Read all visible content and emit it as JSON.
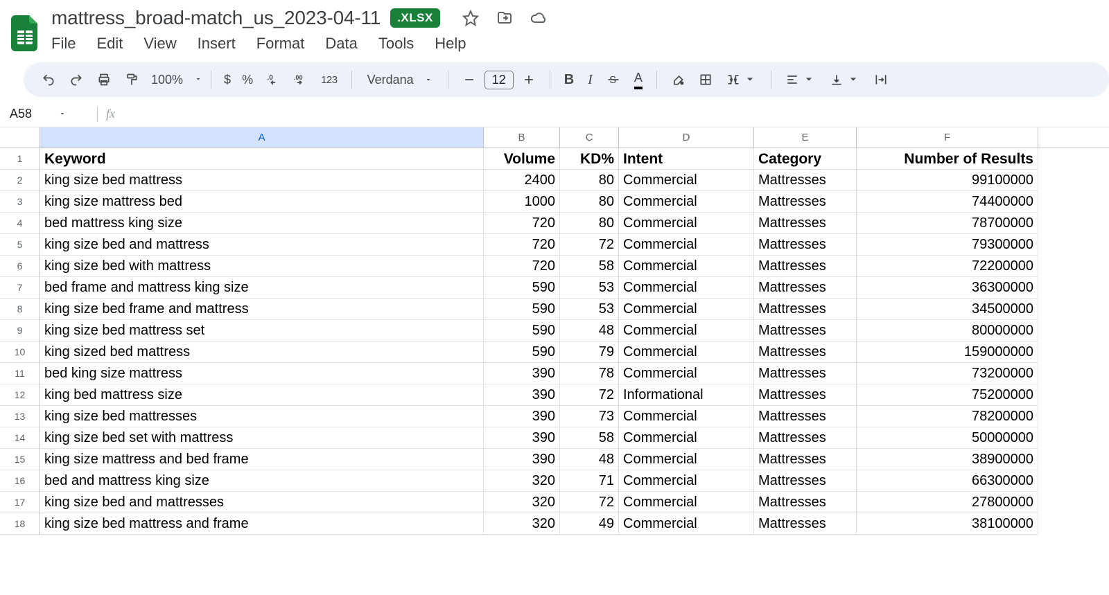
{
  "header": {
    "title": "mattress_broad-match_us_2023-04-11",
    "badge": ".XLSX"
  },
  "menus": [
    "File",
    "Edit",
    "View",
    "Insert",
    "Format",
    "Data",
    "Tools",
    "Help"
  ],
  "toolbar": {
    "zoom": "100%",
    "currency": "$",
    "percent": "%",
    "number_label": "123",
    "font": "Verdana",
    "font_size": "12",
    "text_color_char": "A"
  },
  "fx": {
    "cell_ref": "A58",
    "fx_symbol": "fx",
    "value": ""
  },
  "columns": [
    "A",
    "B",
    "C",
    "D",
    "E",
    "F"
  ],
  "table": {
    "headers": [
      "Keyword",
      "Volume",
      "KD%",
      "Intent",
      "Category",
      "Number of Results"
    ],
    "rows": [
      {
        "n": 2,
        "keyword": "king size bed mattress",
        "volume": 2400,
        "kd": 80,
        "intent": "Commercial",
        "category": "Mattresses",
        "results": 99100000
      },
      {
        "n": 3,
        "keyword": "king size mattress bed",
        "volume": 1000,
        "kd": 80,
        "intent": "Commercial",
        "category": "Mattresses",
        "results": 74400000
      },
      {
        "n": 4,
        "keyword": "bed mattress king size",
        "volume": 720,
        "kd": 80,
        "intent": "Commercial",
        "category": "Mattresses",
        "results": 78700000
      },
      {
        "n": 5,
        "keyword": "king size bed and mattress",
        "volume": 720,
        "kd": 72,
        "intent": "Commercial",
        "category": "Mattresses",
        "results": 79300000
      },
      {
        "n": 6,
        "keyword": "king size bed with mattress",
        "volume": 720,
        "kd": 58,
        "intent": "Commercial",
        "category": "Mattresses",
        "results": 72200000
      },
      {
        "n": 7,
        "keyword": "bed frame and mattress king size",
        "volume": 590,
        "kd": 53,
        "intent": "Commercial",
        "category": "Mattresses",
        "results": 36300000
      },
      {
        "n": 8,
        "keyword": "king size bed frame and mattress",
        "volume": 590,
        "kd": 53,
        "intent": "Commercial",
        "category": "Mattresses",
        "results": 34500000
      },
      {
        "n": 9,
        "keyword": "king size bed mattress set",
        "volume": 590,
        "kd": 48,
        "intent": "Commercial",
        "category": "Mattresses",
        "results": 80000000
      },
      {
        "n": 10,
        "keyword": "king sized bed mattress",
        "volume": 590,
        "kd": 79,
        "intent": "Commercial",
        "category": "Mattresses",
        "results": 159000000
      },
      {
        "n": 11,
        "keyword": "bed king size mattress",
        "volume": 390,
        "kd": 78,
        "intent": "Commercial",
        "category": "Mattresses",
        "results": 73200000
      },
      {
        "n": 12,
        "keyword": "king bed mattress size",
        "volume": 390,
        "kd": 72,
        "intent": "Informational",
        "category": "Mattresses",
        "results": 75200000
      },
      {
        "n": 13,
        "keyword": "king size bed mattresses",
        "volume": 390,
        "kd": 73,
        "intent": "Commercial",
        "category": "Mattresses",
        "results": 78200000
      },
      {
        "n": 14,
        "keyword": "king size bed set with mattress",
        "volume": 390,
        "kd": 58,
        "intent": "Commercial",
        "category": "Mattresses",
        "results": 50000000
      },
      {
        "n": 15,
        "keyword": "king size mattress and bed frame",
        "volume": 390,
        "kd": 48,
        "intent": "Commercial",
        "category": "Mattresses",
        "results": 38900000
      },
      {
        "n": 16,
        "keyword": "bed and mattress king size",
        "volume": 320,
        "kd": 71,
        "intent": "Commercial",
        "category": "Mattresses",
        "results": 66300000
      },
      {
        "n": 17,
        "keyword": "king size bed and mattresses",
        "volume": 320,
        "kd": 72,
        "intent": "Commercial",
        "category": "Mattresses",
        "results": 27800000
      },
      {
        "n": 18,
        "keyword": "king size bed mattress and frame",
        "volume": 320,
        "kd": 49,
        "intent": "Commercial",
        "category": "Mattresses",
        "results": 38100000
      }
    ]
  }
}
